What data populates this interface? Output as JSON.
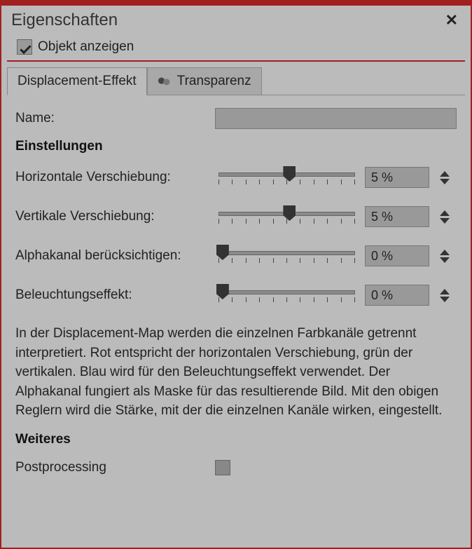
{
  "title": "Eigenschaften",
  "show_object_label": "Objekt anzeigen",
  "show_object_checked": true,
  "tabs": {
    "displacement": "Displacement-Effekt",
    "transparency": "Transparenz"
  },
  "name_label": "Name:",
  "name_value": "",
  "section_settings": "Einstellungen",
  "sliders": {
    "horizontal": {
      "label": "Horizontale Verschiebung:",
      "value": "5 %",
      "pos": 52
    },
    "vertical": {
      "label": "Vertikale Verschiebung:",
      "value": "5 %",
      "pos": 52
    },
    "alpha": {
      "label": "Alphakanal berücksichtigen:",
      "value": "0 %",
      "pos": 3
    },
    "lighting": {
      "label": "Beleuchtungseffekt:",
      "value": "0 %",
      "pos": 3
    }
  },
  "description": "In der Displacement-Map werden die einzelnen Farbkanäle getrennt interpretiert. Rot entspricht der horizontalen Verschiebung, grün der vertikalen. Blau wird für den Beleuchtungseffekt verwendet. Der Alphakanal fungiert als Maske für das resultierende Bild. Mit den obigen Reglern wird die Stärke, mit der die einzelnen Kanäle wirken, eingestellt.",
  "section_more": "Weiteres",
  "postprocessing_label": "Postprocessing",
  "postprocessing_checked": false
}
